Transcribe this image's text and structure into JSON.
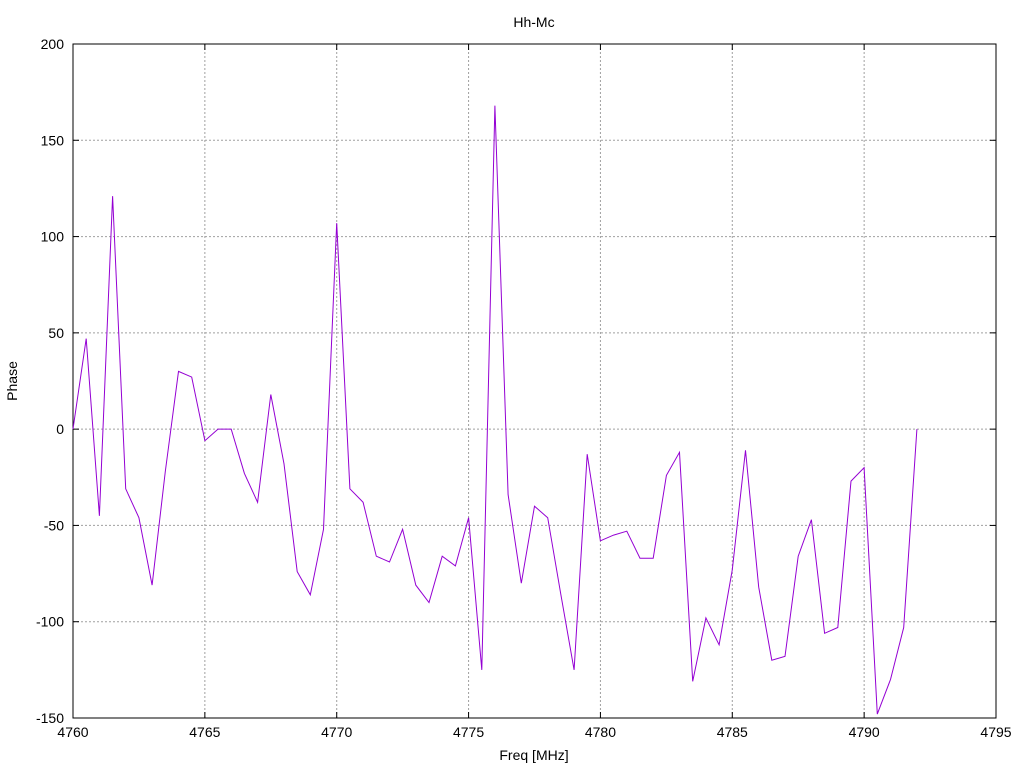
{
  "chart_data": {
    "type": "line",
    "title": "Hh-Mc",
    "xlabel": "Freq [MHz]",
    "ylabel": "Phase",
    "xlim": [
      4760,
      4795
    ],
    "ylim": [
      -150,
      200
    ],
    "xticks": [
      4760,
      4765,
      4770,
      4775,
      4780,
      4785,
      4790,
      4795
    ],
    "yticks": [
      -150,
      -100,
      -50,
      0,
      50,
      100,
      150,
      200
    ],
    "xtick_labels": [
      "4760",
      "4765",
      "4770",
      "4775",
      "4780",
      "4785",
      "4790",
      "4795"
    ],
    "ytick_labels": [
      "-150",
      "-100",
      "-50",
      "0",
      "50",
      "100",
      "150",
      "200"
    ],
    "grid": true,
    "line_color": "#9400d3",
    "series": [
      {
        "x": [
          4760,
          4760.5,
          4761,
          4761.5,
          4762,
          4762.5,
          4763,
          4763.5,
          4764,
          4764.5,
          4765,
          4765.5,
          4766,
          4766.5,
          4767,
          4767.5,
          4768,
          4768.5,
          4769,
          4769.5,
          4770,
          4770.5,
          4771,
          4771.5,
          4772,
          4772.5,
          4773,
          4773.5,
          4774,
          4774.5,
          4775,
          4775.5,
          4776,
          4776.5,
          4777,
          4777.5,
          4778,
          4778.5,
          4779,
          4779.5,
          4780,
          4780.5,
          4781,
          4781.5,
          4782,
          4782.5,
          4783,
          4783.5,
          4784,
          4784.5,
          4785,
          4785.5,
          4786,
          4786.5,
          4787,
          4787.5,
          4788,
          4788.5,
          4789,
          4789.5,
          4790,
          4790.5,
          4791,
          4791.5,
          4792
        ],
        "y": [
          0,
          47,
          -45,
          121,
          -31,
          -46,
          -81,
          -22,
          30,
          27,
          -6,
          0,
          0,
          -23,
          -38,
          18,
          -18,
          -74,
          -86,
          -52,
          107,
          -31,
          -38,
          -66,
          -69,
          -52,
          -81,
          -90,
          -66,
          -71,
          -46,
          -125,
          168,
          -34,
          -80,
          -40,
          -46,
          -86,
          -125,
          -13,
          -58,
          -55,
          -53,
          -67,
          -67,
          -24,
          -12,
          -131,
          -98,
          -112,
          -73,
          -11,
          -82,
          -120,
          -118,
          -66,
          -47,
          -106,
          -103,
          -27,
          -20,
          -148,
          -130,
          -103,
          0
        ]
      }
    ]
  }
}
